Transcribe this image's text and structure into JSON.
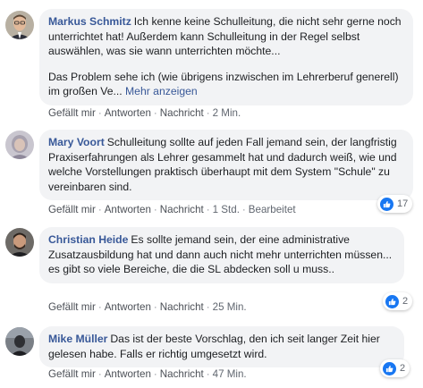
{
  "comments": [
    {
      "author": "Markus Schmitz",
      "text": "Ich kenne keine Schulleitung, die nicht sehr gerne noch unterrichtet hat! Außerdem kann Schulleitung in der Regel selbst auswählen, was sie wann unterrichten möchte...",
      "text2": "Das Problem sehe ich (wie übrigens inzwischen im Lehrerberuf generell) im großen Ve...",
      "more": "Mehr anzeigen",
      "like": "Gefällt mir",
      "reply": "Antworten",
      "message": "Nachricht",
      "time": "2 Min."
    },
    {
      "author": "Mary Voort",
      "text": "Schulleitung sollte auf jeden Fall jemand sein, der langfristig Praxiserfahrungen als Lehrer gesammelt hat und dadurch weiß, wie und welche Vorstellungen praktisch überhaupt mit dem System \"Schule\" zu vereinbaren sind.",
      "like": "Gefällt mir",
      "reply": "Antworten",
      "message": "Nachricht",
      "time": "1 Std.",
      "edited": "Bearbeitet",
      "reactions": "17"
    },
    {
      "author": "Christian Heide",
      "text": "Es sollte jemand sein, der eine administrative Zusatzausbildung hat und dann auch nicht mehr unterrichten müssen... es gibt so viele Bereiche, die die SL abdecken soll u muss..",
      "like": "Gefällt mir",
      "reply": "Antworten",
      "message": "Nachricht",
      "time": "25 Min.",
      "reactions": "2"
    },
    {
      "author": "Mike Müller",
      "text": "Das ist der beste Vorschlag, den ich seit langer Zeit hier gelesen habe. Falls er richtig umgesetzt wird.",
      "like": "Gefällt mir",
      "reply": "Antworten",
      "message": "Nachricht",
      "time": "47 Min.",
      "reactions": "2"
    }
  ],
  "colors": {
    "name": "#385898",
    "bubble": "#f2f3f5",
    "like": "#1877f2"
  }
}
